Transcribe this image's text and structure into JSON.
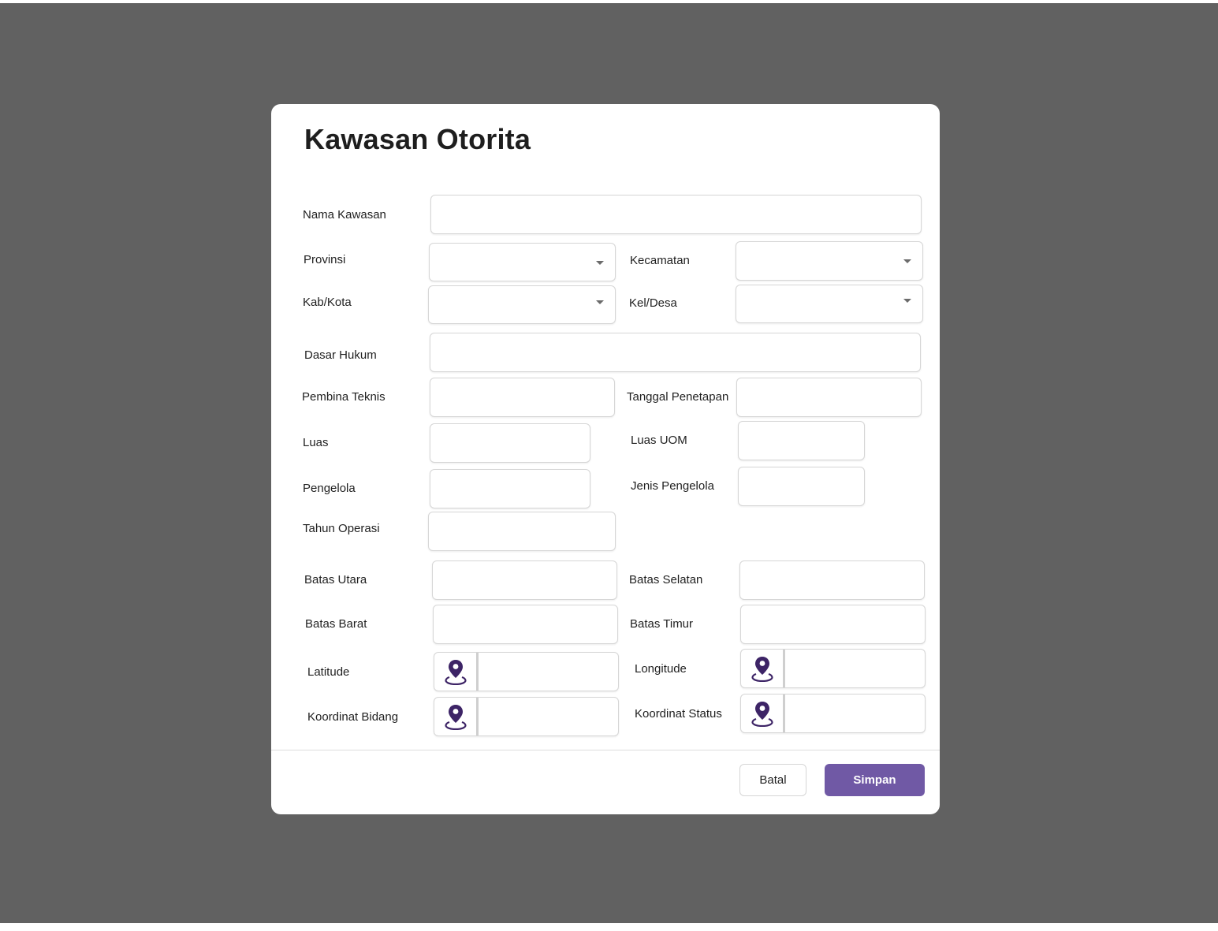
{
  "dialog": {
    "title": "Kawasan Otorita",
    "labels": {
      "nama_kawasan": "Nama Kawasan",
      "provinsi": "Provinsi",
      "kecamatan": "Kecamatan",
      "kab_kota": "Kab/Kota",
      "kel_desa": "Kel/Desa",
      "dasar_hukum": "Dasar Hukum",
      "pembina_teknis": "Pembina Teknis",
      "tanggal_penetapan": "Tanggal Penetapan",
      "luas": "Luas",
      "luas_uom": "Luas UOM",
      "pengelola": "Pengelola",
      "jenis_pengelola": "Jenis Pengelola",
      "tahun_operasi": "Tahun Operasi",
      "batas_utara": "Batas Utara",
      "batas_selatan": "Batas Selatan",
      "batas_barat": "Batas Barat",
      "batas_timur": "Batas Timur",
      "latitude": "Latitude",
      "longitude": "Longitude",
      "koordinat_bidang": "Koordinat Bidang",
      "koordinat_status": "Koordinat Status"
    },
    "values": {
      "nama_kawasan": "",
      "provinsi": "",
      "kecamatan": "",
      "kab_kota": "",
      "kel_desa": "",
      "dasar_hukum": "",
      "pembina_teknis": "",
      "tanggal_penetapan": "",
      "luas": "",
      "luas_uom": "",
      "pengelola": "",
      "jenis_pengelola": "",
      "tahun_operasi": "",
      "batas_utara": "",
      "batas_selatan": "",
      "batas_barat": "",
      "batas_timur": "",
      "latitude": "",
      "longitude": "",
      "koordinat_bidang": "",
      "koordinat_status": ""
    },
    "icons": {
      "dropdown": "caret-down-icon",
      "location": "map-pin-icon"
    },
    "buttons": {
      "cancel": "Batal",
      "save": "Simpan"
    }
  },
  "colors": {
    "backdrop": "#616161",
    "primary": "#7059a5",
    "pin_icon": "#3d2466"
  }
}
